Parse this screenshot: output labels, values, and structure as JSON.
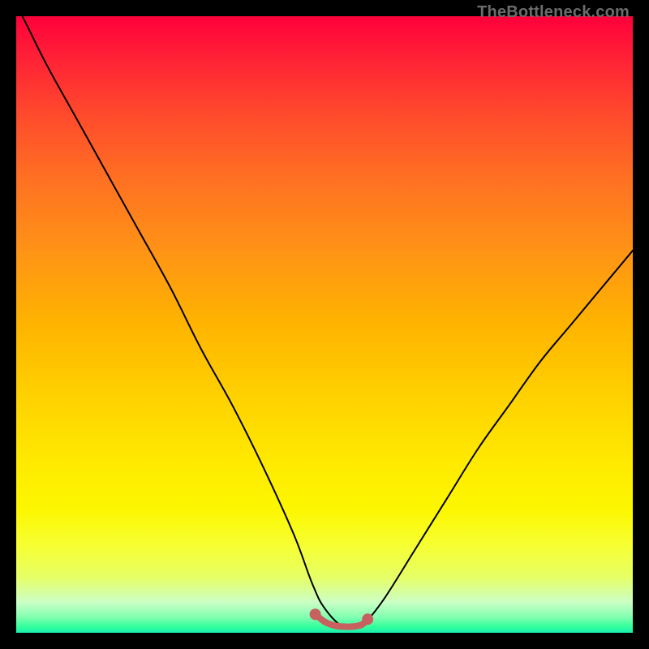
{
  "watermark": "TheBottleneck.com",
  "colors": {
    "frame": "#000000",
    "curve_stroke": "#000000",
    "trough_color": "#c96060",
    "gradient_top": "#ff003a",
    "gradient_bottom": "#1aefaf"
  },
  "chart_data": {
    "type": "line",
    "title": "",
    "xlabel": "",
    "ylabel": "",
    "xlim": [
      0,
      100
    ],
    "ylim": [
      0,
      100
    ],
    "series": [
      {
        "name": "bottleneck-curve",
        "x": [
          0,
          2,
          5,
          10,
          15,
          20,
          25,
          30,
          35,
          40,
          45,
          48,
          50,
          53,
          56,
          57,
          60,
          65,
          70,
          75,
          80,
          85,
          90,
          95,
          100
        ],
        "values": [
          102,
          98,
          92,
          83,
          74,
          65,
          56,
          46,
          37,
          27,
          16,
          8,
          4,
          1,
          1,
          2,
          6,
          14,
          22,
          30,
          37,
          44,
          50,
          56,
          62
        ]
      }
    ],
    "trough": {
      "x_points": [
        48.5,
        50,
        51.5,
        53,
        54.5,
        56,
        57
      ],
      "y_points": [
        3.0,
        1.8,
        1.2,
        1.0,
        1.0,
        1.3,
        2.2
      ],
      "endpoints": [
        {
          "x": 48.5,
          "y": 3.0
        },
        {
          "x": 57.0,
          "y": 2.2
        }
      ]
    }
  }
}
